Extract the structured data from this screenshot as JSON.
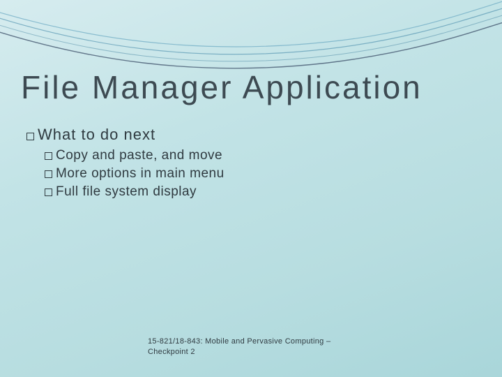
{
  "title": "File Manager Application",
  "content": {
    "heading": "What to do next",
    "items": [
      "Copy and paste, and move",
      "More options in main menu",
      "Full file system display"
    ]
  },
  "footer": {
    "line1": "15-821/18-843: Mobile and Pervasive Computing –",
    "line2": "Checkpoint 2"
  }
}
